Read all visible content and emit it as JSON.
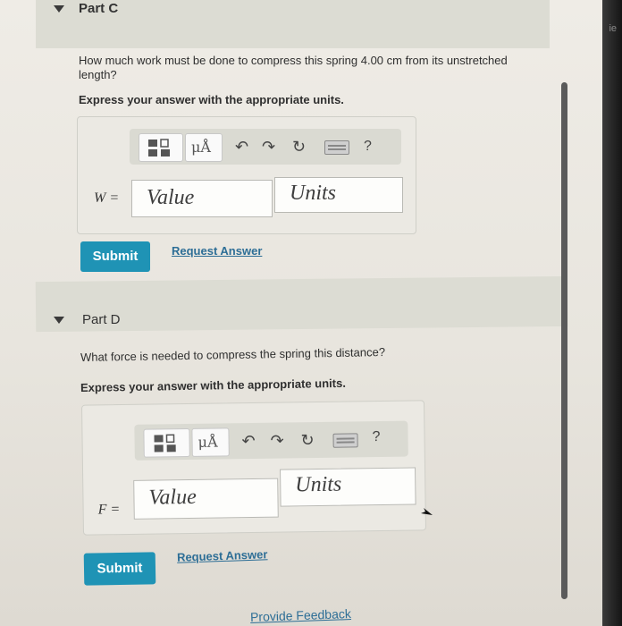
{
  "partC": {
    "title": "Part C",
    "question_line1": "How much work must be done to compress this spring 4.00 cm from its unstretched",
    "question_line2": "length?",
    "instruction": "Express your answer with the appropriate units.",
    "variable": "W =",
    "value_placeholder": "Value",
    "units_placeholder": "Units",
    "submit_label": "Submit",
    "request_label": "Request Answer"
  },
  "partD": {
    "title": "Part D",
    "question": "What force is needed to compress the spring this distance?",
    "instruction": "Express your answer with the appropriate units.",
    "variable": "F =",
    "value_placeholder": "Value",
    "units_placeholder": "Units",
    "submit_label": "Submit",
    "request_label": "Request Answer"
  },
  "toolbar": {
    "units_symbol": "μÅ",
    "undo_icon": "↶",
    "redo_icon": "↷",
    "reset_icon": "↻",
    "help_label": "?"
  },
  "footer": {
    "feedback_label": "Provide Feedback"
  },
  "edge_text": "ie"
}
